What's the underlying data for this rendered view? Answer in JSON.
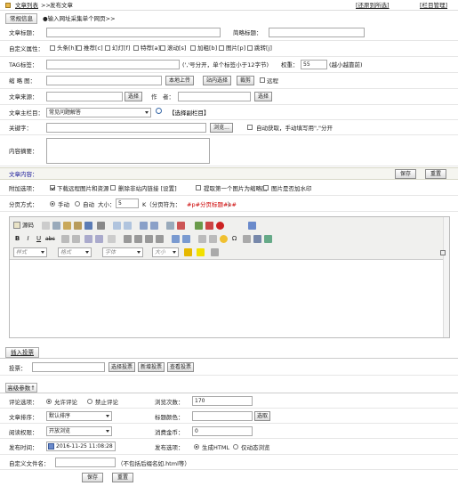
{
  "nav": {
    "breadcrumb_list": "文章列表",
    "sep": ">>",
    "current": "发布文章",
    "link_restore": "[还原到所选]",
    "link_manage": "[栏目管理]"
  },
  "tabs": {
    "basic": "常规信息",
    "hint": "●输入网址采集单个网页>>"
  },
  "form": {
    "title_label": "文章标题：",
    "short_title_label": "简略标题：",
    "custom_attr_label": "自定义属性：",
    "attrs": [
      "头条[h]",
      "推荐[c]",
      "幻灯[f]",
      "特荐[a]",
      "滚动[s]",
      "加粗[b]",
      "图片[p]",
      "跳转[j]"
    ],
    "tag_label": "TAG标签：",
    "tag_hint": "(','号分开，单个标签小于12字节)",
    "weight_label": "权重：",
    "weight_value": "55",
    "weight_hint": "(越小越靠前)",
    "thumb_label": "缩 略 图：",
    "btn_local_upload": "本地上传",
    "btn_site_select": "站内选择",
    "btn_crop": "裁剪",
    "remote_label": "远程",
    "source_label": "文章来源：",
    "btn_select_source": "选择",
    "author_label": "作　者：",
    "btn_select_author": "选择",
    "column_label": "文章主栏目：",
    "column_value": "常见问题解答",
    "column_link": "【选择副栏目】",
    "keywords_label": "关键字：",
    "btn_browse": "浏览...",
    "auto_keywords_label": "自动获取，手动填写用\",\"分开",
    "summary_label": "内容摘要："
  },
  "content_bar": {
    "title": "文章内容：",
    "btn_save": "保存",
    "btn_reset": "重置"
  },
  "options": {
    "extra_label": "附加选项：",
    "opt1": "下载远程图片和资源",
    "opt2": "删除非站内链接 [设置]",
    "opt3": "提取第一个图片为缩略图",
    "opt4": "图片是否加水印",
    "paging_label": "分页方式：",
    "paging_manual": "手动",
    "paging_auto": "自动",
    "size_label": "大小：",
    "size_value": "5",
    "size_unit": "K（分页符为：",
    "page_sep": "#p#分页标题#e#",
    "page_sep_end": "）"
  },
  "editor": {
    "source_label": "源码",
    "style_combo": "样式",
    "format_combo": "格式",
    "font_combo": "字体",
    "size_combo": "大小"
  },
  "vote": {
    "tab": "插入投票",
    "label": "投票：",
    "btn_select": "选择投票",
    "btn_new": "新增投票",
    "btn_view": "查看投票"
  },
  "advanced": {
    "tab": "高级参数↑",
    "comment_label": "评论选项：",
    "comment_allow": "允许评论",
    "comment_deny": "禁止评论",
    "views_label": "浏览次数：",
    "views_value": "170",
    "sort_label": "文章排序：",
    "sort_value": "默认排序",
    "title_color_label": "标题颜色：",
    "btn_pick": "选取",
    "read_perm_label": "阅读权限：",
    "read_perm_value": "开放浏览",
    "gold_label": "消费金币：",
    "gold_value": "0",
    "time_label": "发布时间：",
    "time_value": "2016-11-25 11:08:28",
    "publish_label": "发布选项：",
    "publish_html": "生成HTML",
    "publish_dynamic": "仅动态浏览",
    "filename_label": "自定义文件名：",
    "filename_hint": "（不包括后缀名如.html等）",
    "btn_save": "保存",
    "btn_reset": "重置"
  },
  "colors": {
    "accent_red": "#cc0000",
    "bar_bg": "#f5f5f0",
    "border": "#a9a9a9"
  }
}
